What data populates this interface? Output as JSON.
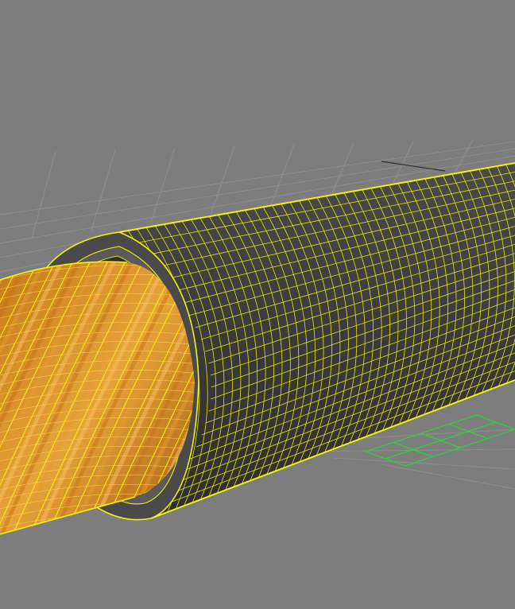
{
  "scene": {
    "background": "#7d7d7d",
    "ground_grid_color": "#8e8e8e",
    "selected_grid_color": "#2fd23a",
    "wire_color": "#f2f20d",
    "jacket_color": "#3c3c3c",
    "ring_color": "#4a4a4a",
    "core_colors": [
      "#b86a14",
      "#d8902c",
      "#f0b050"
    ],
    "objects": [
      {
        "name": "stranded-core",
        "icon": "cable-core"
      },
      {
        "name": "insulation-ring",
        "icon": "ring"
      },
      {
        "name": "cable-jacket",
        "icon": "cylinder-mesh"
      }
    ]
  }
}
